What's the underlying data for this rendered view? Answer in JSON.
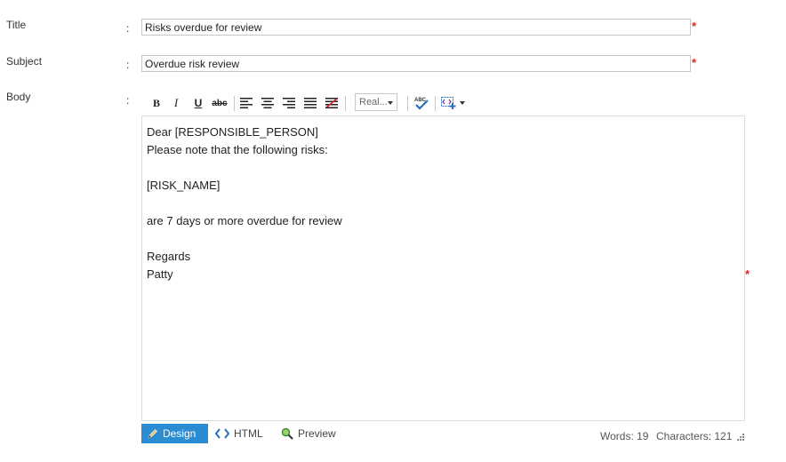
{
  "fields": {
    "title": {
      "label": "Title",
      "colon": ":",
      "value": "Risks overdue for review",
      "required": "*"
    },
    "subject": {
      "label": "Subject",
      "colon": ":",
      "value": "Overdue risk review",
      "required": "*"
    },
    "body": {
      "label": "Body",
      "colon": ":",
      "required": "*"
    }
  },
  "toolbar": {
    "bold": "B",
    "italic": "I",
    "underline": "U",
    "strikethrough": "abc",
    "font_name": "Real...",
    "spellcheck": "ABC",
    "icons": [
      "align-left-icon",
      "align-center-icon",
      "align-right-icon",
      "align-justify-icon",
      "clear-format-icon",
      "spellcheck-icon",
      "insert-snippet-icon",
      "chevron-down-icon"
    ]
  },
  "editor": {
    "lines": [
      "Dear [RESPONSIBLE_PERSON]",
      "Please note that the following risks:",
      "",
      "[RISK_NAME]",
      "",
      "are 7 days or more overdue for review",
      "",
      "Regards",
      "Patty"
    ]
  },
  "modes": {
    "design": "Design",
    "html": "HTML",
    "preview": "Preview",
    "active": "design"
  },
  "stats": {
    "words": "Words: 19",
    "characters": "Characters: 121"
  },
  "colors": {
    "accent": "#2a8dd4",
    "required": "#e02020",
    "border": "#c6c6c6"
  }
}
